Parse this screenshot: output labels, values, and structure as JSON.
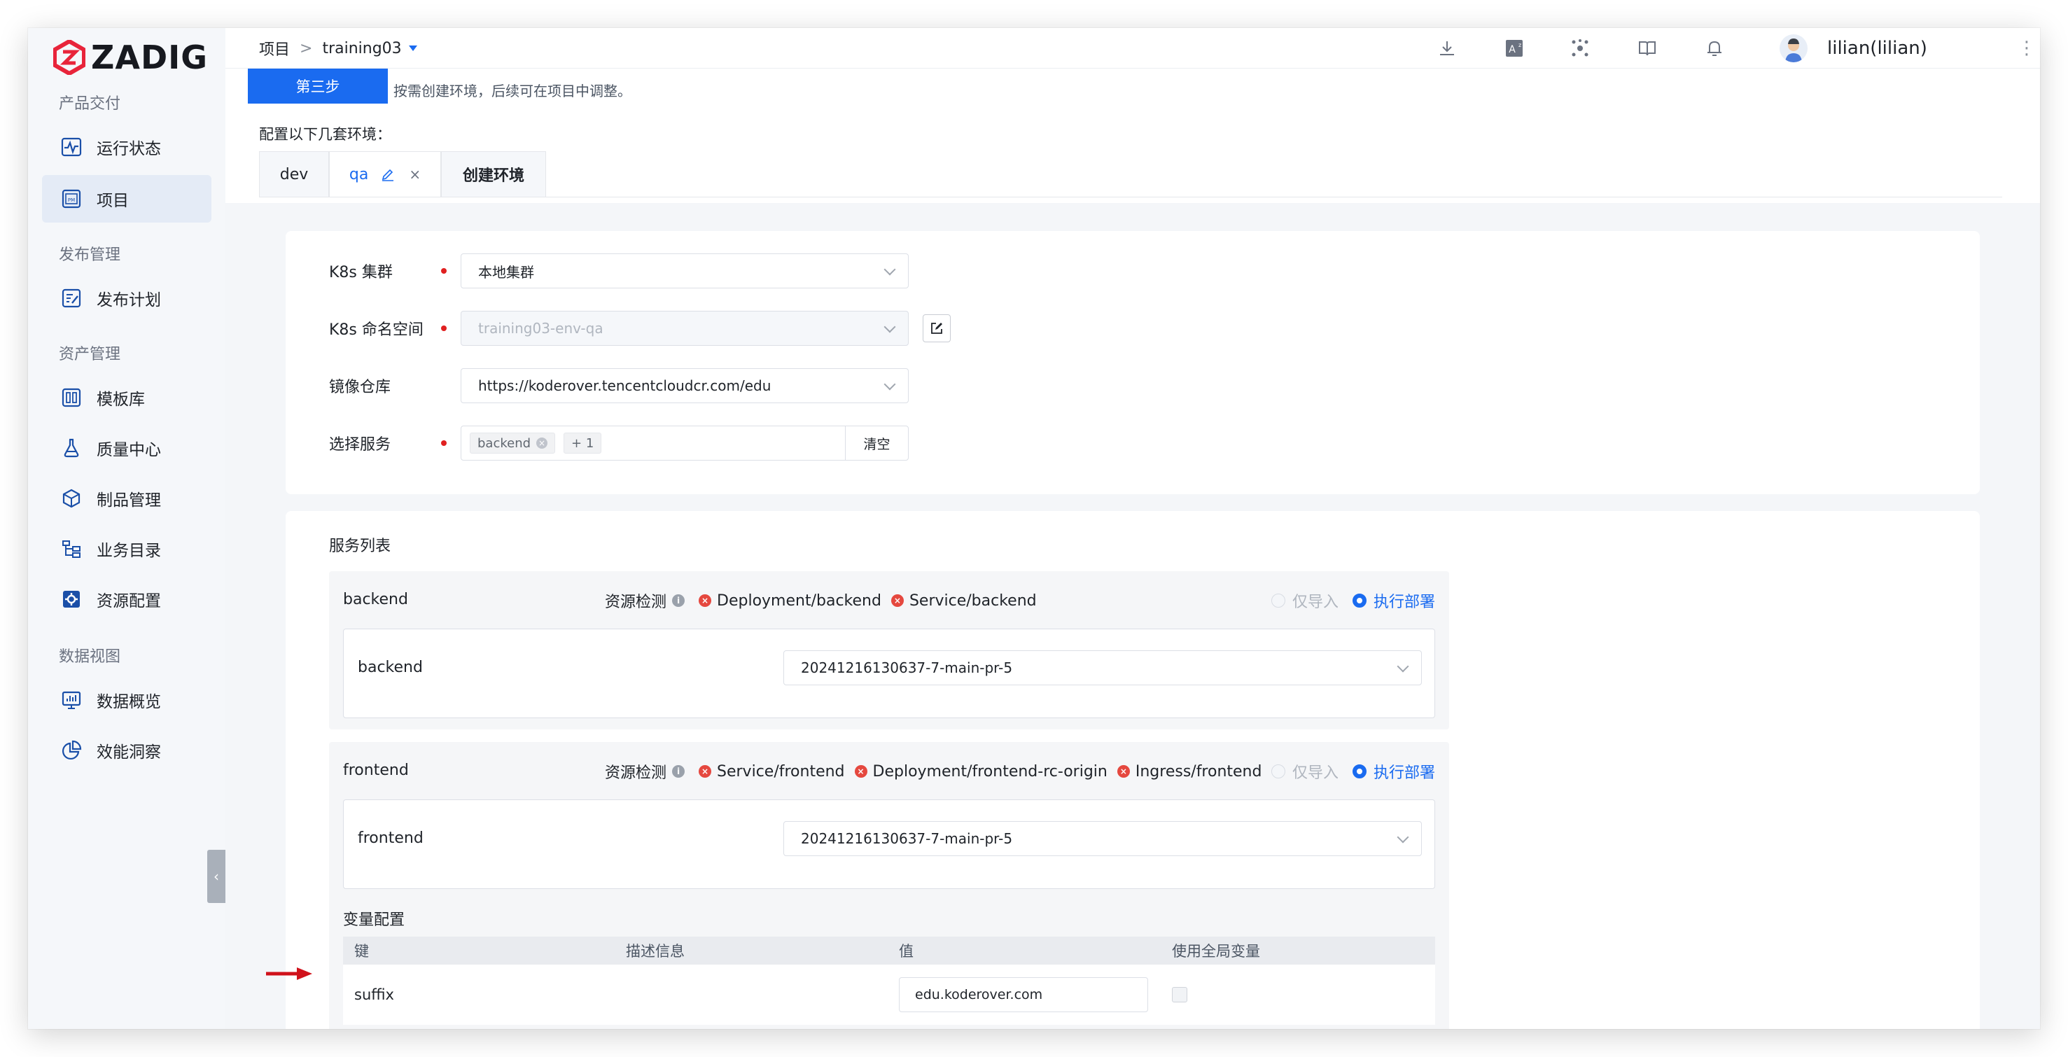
{
  "logo": {
    "text": "ZADIG"
  },
  "sidebar": {
    "groups": [
      {
        "label": "产品交付"
      },
      {
        "label": "发布管理"
      },
      {
        "label": "资产管理"
      },
      {
        "label": "数据视图"
      }
    ],
    "items": [
      {
        "label": "运行状态",
        "icon": "pulse-icon"
      },
      {
        "label": "项目",
        "icon": "project-icon",
        "active": true
      },
      {
        "label": "发布计划",
        "icon": "release-plan-icon"
      },
      {
        "label": "模板库",
        "icon": "template-icon"
      },
      {
        "label": "质量中心",
        "icon": "flask-icon"
      },
      {
        "label": "制品管理",
        "icon": "package-icon"
      },
      {
        "label": "业务目录",
        "icon": "tree-icon"
      },
      {
        "label": "资源配置",
        "icon": "gear-icon"
      },
      {
        "label": "数据概览",
        "icon": "chart-icon"
      },
      {
        "label": "效能洞察",
        "icon": "pie-icon"
      }
    ]
  },
  "header": {
    "breadcrumb_root": "项目",
    "breadcrumb_sep": ">",
    "project": "training03",
    "user": "lilian(lilian)",
    "more": "⋮"
  },
  "step": {
    "tag": "第三步",
    "desc": "按需创建环境，后续可在项目中调整。",
    "envs_label": "配置以下几套环境："
  },
  "env_tabs": [
    {
      "label": "dev"
    },
    {
      "label": "qa"
    },
    {
      "label": "创建环境"
    }
  ],
  "form": {
    "cluster_label": "K8s 集群",
    "cluster_value": "本地集群",
    "namespace_label": "K8s 命名空间",
    "namespace_value": "training03-env-qa",
    "registry_label": "镜像仓库",
    "registry_value": "https://koderover.tencentcloudcr.com/edu",
    "services_label": "选择服务",
    "services_tags": [
      "backend",
      "+ 1"
    ],
    "clear_label": "清空"
  },
  "service_list": {
    "title": "服务列表",
    "res_check_label": "资源检测",
    "import_only_label": "仅导入",
    "deploy_label": "执行部署",
    "services": [
      {
        "name": "backend",
        "resources": [
          "Deployment/backend",
          "Service/backend"
        ],
        "inner_name": "backend",
        "image": "20241216130637-7-main-pr-5"
      },
      {
        "name": "frontend",
        "resources": [
          "Service/frontend",
          "Deployment/frontend-rc-origin",
          "Ingress/frontend"
        ],
        "inner_name": "frontend",
        "image": "20241216130637-7-main-pr-5"
      }
    ],
    "vars": {
      "title": "变量配置",
      "columns": [
        "键",
        "描述信息",
        "值",
        "使用全局变量"
      ],
      "rows": [
        {
          "key": "suffix",
          "desc": "",
          "value": "edu.koderover.com"
        }
      ]
    }
  },
  "colors": {
    "accent": "#1a6bf0",
    "required": "#e02020",
    "error": "#e5483f",
    "annotation_arrow": "#d0121b"
  }
}
